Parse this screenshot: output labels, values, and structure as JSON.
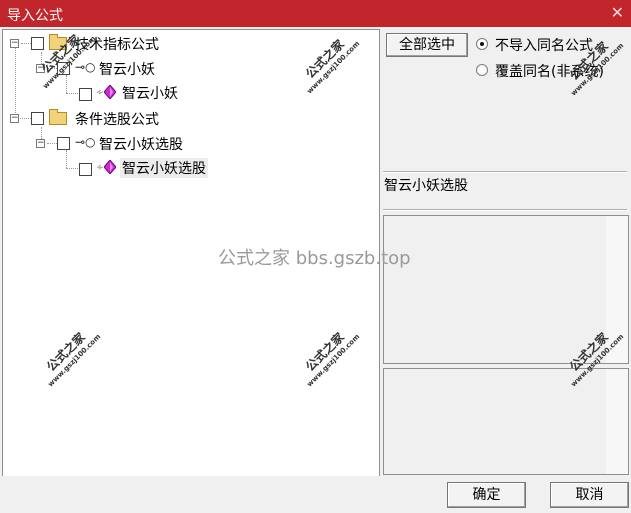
{
  "window": {
    "title": "导入公式",
    "close_glyph": "✕"
  },
  "tree": {
    "nodes": [
      {
        "label": "技术指标公式",
        "icon": "folder-icon"
      },
      {
        "label": "智云小妖",
        "icon": "key-icon"
      },
      {
        "label": "智云小妖",
        "icon": "gem-icon"
      },
      {
        "label": "条件选股公式",
        "icon": "folder-icon"
      },
      {
        "label": "智云小妖选股",
        "icon": "key-icon"
      },
      {
        "label": "智云小妖选股",
        "icon": "gem-icon",
        "selected": true
      }
    ]
  },
  "options": {
    "select_all_label": "全部选中",
    "radio_no_import_label": "不导入同名公式",
    "radio_overwrite_label": "覆盖同名(非系统)",
    "selected_radio": "不导入同名公式"
  },
  "details": {
    "formula_name": "智云小妖选股"
  },
  "buttons": {
    "ok_label": "确定",
    "cancel_label": "取消"
  },
  "watermark": {
    "center_text": "公式之家 bbs.gszb.top",
    "stamp_title": "公式之家",
    "stamp_url": "www.gszj100.com"
  },
  "colors": {
    "titlebar": "#c0262b",
    "gem": "#cc2ad6"
  }
}
